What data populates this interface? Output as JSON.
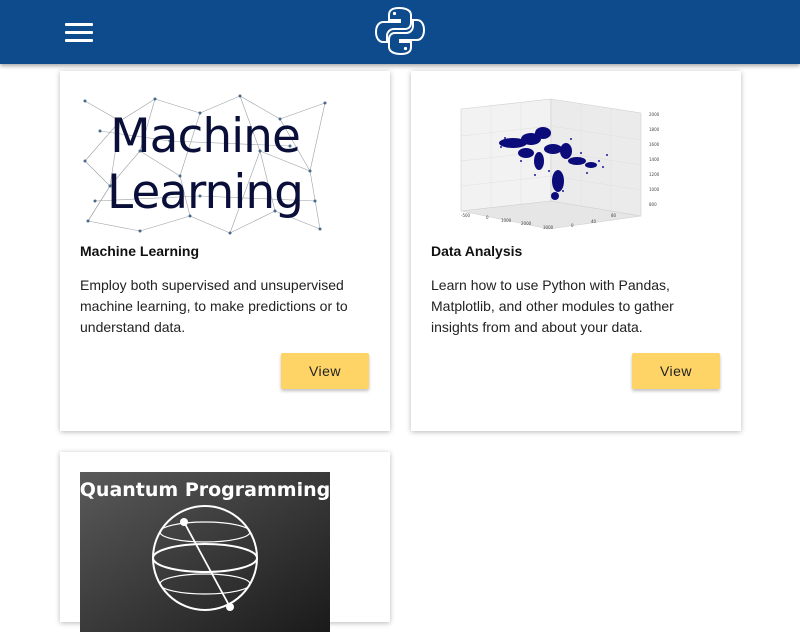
{
  "header": {
    "menu_icon": "hamburger-menu-icon",
    "logo_icon": "python-logo-icon",
    "background_color": "#0d4b8c"
  },
  "cards": [
    {
      "title": "Machine Learning",
      "description": "Employ both supervised and unsupervised machine learning, to make predictions or to understand data.",
      "button_label": "View",
      "image_text_line1": "Machine",
      "image_text_line2": "Learning"
    },
    {
      "title": "Data Analysis",
      "description": "Learn how to use Python with Pandas, Matplotlib, and other modules to gather insights from and about your data.",
      "button_label": "View"
    },
    {
      "title": "",
      "image_text": "Quantum Programming"
    }
  ],
  "colors": {
    "button": "#ffd467",
    "card_background": "#ffffff"
  }
}
